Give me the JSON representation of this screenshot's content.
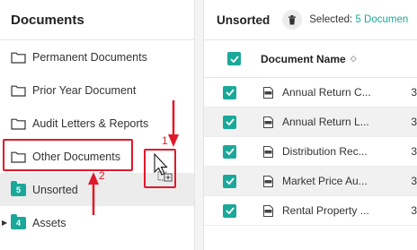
{
  "left": {
    "title": "Documents",
    "folders": [
      {
        "label": "Permanent Documents",
        "icon": "folder-outline-icon"
      },
      {
        "label": "Prior Year Document",
        "icon": "folder-outline-icon"
      },
      {
        "label": "Audit Letters & Reports",
        "icon": "folder-outline-icon"
      },
      {
        "label": "Other Documents",
        "icon": "folder-outline-icon"
      },
      {
        "label": "Unsorted",
        "icon": "folder-filled-icon",
        "badge": "5"
      },
      {
        "label": "Assets",
        "icon": "folder-filled-icon",
        "badge": "4"
      }
    ]
  },
  "right": {
    "title": "Unsorted",
    "selected_label": "Selected: ",
    "selected_count": "5 Documen",
    "column_name": "Document Name",
    "rows": [
      {
        "name": "Annual Return C...",
        "col3": "3"
      },
      {
        "name": "Annual Return L...",
        "col3": "3"
      },
      {
        "name": "Distribution Rec...",
        "col3": "3"
      },
      {
        "name": "Market Price Au...",
        "col3": "3"
      },
      {
        "name": "Rental Property ...",
        "col3": "3"
      }
    ]
  },
  "annotations": {
    "label_1": "1",
    "label_2": "2"
  },
  "colors": {
    "accent": "#1aa89a",
    "annotation": "#e0192a"
  }
}
